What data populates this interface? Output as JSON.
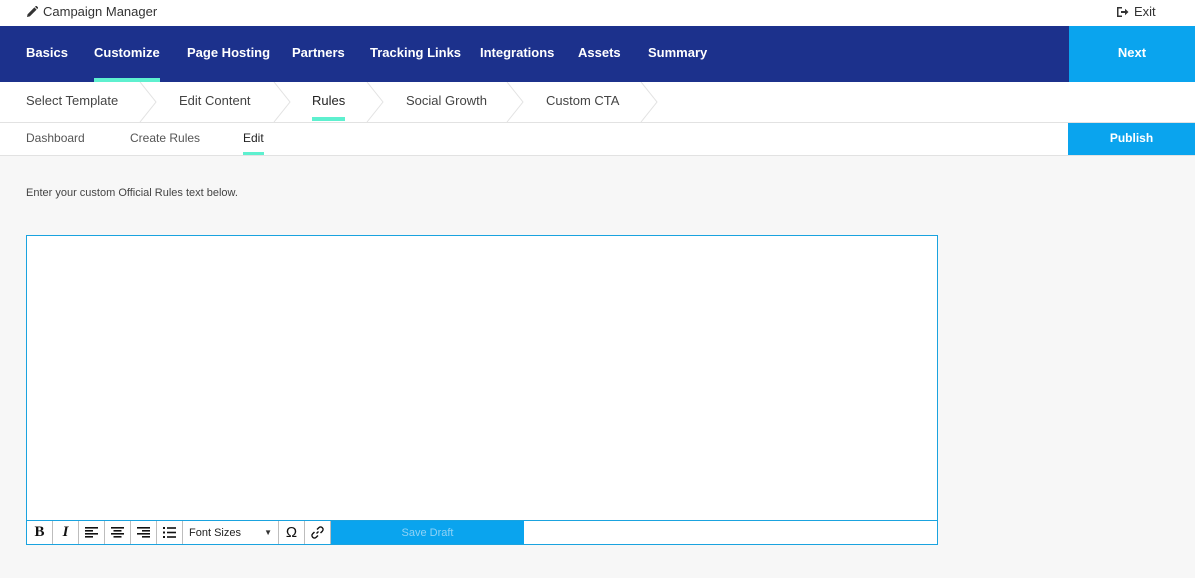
{
  "app": {
    "title": "Campaign Manager",
    "exit_label": "Exit"
  },
  "main_nav": {
    "items": [
      {
        "label": "Basics",
        "active": false
      },
      {
        "label": "Customize",
        "active": true
      },
      {
        "label": "Page Hosting",
        "active": false
      },
      {
        "label": "Partners",
        "active": false
      },
      {
        "label": "Tracking Links",
        "active": false
      },
      {
        "label": "Integrations",
        "active": false
      },
      {
        "label": "Assets",
        "active": false
      },
      {
        "label": "Summary",
        "active": false
      }
    ],
    "next_label": "Next"
  },
  "steps": {
    "items": [
      {
        "label": "Select Template",
        "active": false
      },
      {
        "label": "Edit Content",
        "active": false
      },
      {
        "label": "Rules",
        "active": true
      },
      {
        "label": "Social Growth",
        "active": false
      },
      {
        "label": "Custom CTA",
        "active": false
      }
    ]
  },
  "sub_nav": {
    "items": [
      {
        "label": "Dashboard",
        "active": false
      },
      {
        "label": "Create Rules",
        "active": false
      },
      {
        "label": "Edit",
        "active": true
      }
    ],
    "publish_label": "Publish"
  },
  "editor": {
    "instructions": "Enter your custom Official Rules text below.",
    "content": "",
    "toolbar": {
      "bold_label": "B",
      "italic_label": "I",
      "font_sizes_label": "Font Sizes",
      "omega_label": "Ω",
      "save_draft_label": "Save Draft"
    }
  },
  "colors": {
    "nav_background": "#1c318c",
    "accent_blue": "#0aa4ee",
    "active_underline": "#5ef0cf",
    "editor_border": "#1aa3df"
  }
}
